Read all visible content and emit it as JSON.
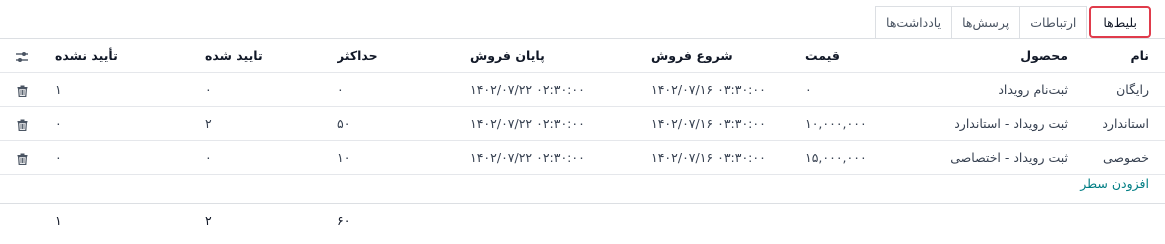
{
  "tabs": [
    {
      "label": "بلیط‌ها",
      "active": true
    },
    {
      "label": "ارتباطات",
      "active": false
    },
    {
      "label": "پرسش‌ها",
      "active": false
    },
    {
      "label": "یادداشت‌ها",
      "active": false
    }
  ],
  "table": {
    "headers": {
      "name": "نام",
      "product": "محصول",
      "price": "قیمت",
      "sale_start": "شروع فروش",
      "sale_end": "پایان فروش",
      "max": "حداکثر",
      "confirmed": "تایید شده",
      "unconfirmed": "تأیید نشده"
    },
    "settings_icon": "sliders-icon",
    "rows": [
      {
        "name": "رایگان",
        "product": "ثبت‌نام رویداد",
        "price": "۰",
        "sale_start": "۱۴۰۲/۰۷/۱۶ ۰۳:۳۰:۰۰",
        "sale_end": "۱۴۰۲/۰۷/۲۲ ۰۲:۳۰:۰۰",
        "max": "۰",
        "confirmed": "۰",
        "unconfirmed": "۱"
      },
      {
        "name": "استاندارد",
        "product": "ثبت رویداد - استاندارد",
        "price": "۱۰,۰۰۰,۰۰۰",
        "sale_start": "۱۴۰۲/۰۷/۱۶ ۰۳:۳۰:۰۰",
        "sale_end": "۱۴۰۲/۰۷/۲۲ ۰۲:۳۰:۰۰",
        "max": "۵۰",
        "confirmed": "۲",
        "unconfirmed": "۰"
      },
      {
        "name": "خصوصی",
        "product": "ثبت رویداد - اختصاصی",
        "price": "۱۵,۰۰۰,۰۰۰",
        "sale_start": "۱۴۰۲/۰۷/۱۶ ۰۳:۳۰:۰۰",
        "sale_end": "۱۴۰۲/۰۷/۲۲ ۰۲:۳۰:۰۰",
        "max": "۱۰",
        "confirmed": "۰",
        "unconfirmed": "۰"
      }
    ],
    "row_action_icon": "trash-icon",
    "add_line": "افزودن سطر",
    "totals": {
      "max": "۶۰",
      "confirmed": "۲",
      "unconfirmed": "۱"
    }
  },
  "colors": {
    "active_tab_border": "#e03b4b",
    "link": "#017e84"
  }
}
